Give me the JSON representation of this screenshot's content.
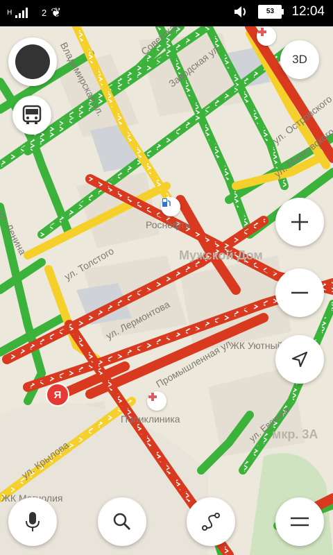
{
  "status_bar": {
    "network_label": "2",
    "battery_level": "53",
    "time": "12:04"
  },
  "map": {
    "street_labels": [
      "Владимирская ул.",
      "Советская",
      "Заводская ул.",
      "ул. Островского",
      "ул. Маяковского",
      "ул. Ленина",
      "ул. Толстого",
      "ул. Лермонтова",
      "Промышленная ул.",
      "ул. Крылова",
      "ул. Евскина"
    ],
    "poi_labels": [
      "Роснефть",
      "Поликлиника"
    ],
    "area_labels": [
      "Мужской Дом",
      "ЖК Уютный",
      "мкр. 3А",
      "ЖК Магнолия"
    ],
    "user_marker_label": "Я"
  },
  "controls": {
    "mode_3d_label": "3D",
    "icons": [
      "profile-icon",
      "bus-icon",
      "3d-toggle",
      "zoom-in-icon",
      "zoom-out-icon",
      "location-icon",
      "microphone-icon",
      "search-icon",
      "route-icon",
      "menu-icon"
    ]
  },
  "colors": {
    "traffic_free": "#3bb33b",
    "traffic_medium": "#f5d02a",
    "traffic_jam": "#d8391f",
    "map_background": "#ede8dc",
    "user_marker": "#e53935"
  }
}
